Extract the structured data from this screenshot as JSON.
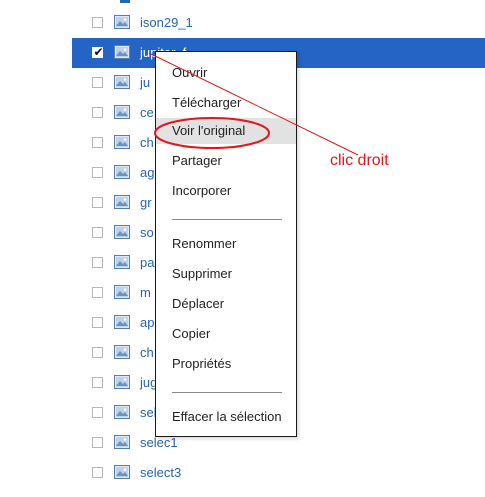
{
  "file_list": {
    "rows": [
      {
        "name": "ison29_1",
        "selected": false
      },
      {
        "name": "jupiter_f",
        "selected": true
      },
      {
        "name": "ju",
        "selected": false
      },
      {
        "name": "ce",
        "selected": false
      },
      {
        "name": "ch",
        "selected": false
      },
      {
        "name": "ag",
        "selected": false
      },
      {
        "name": "gr",
        "selected": false
      },
      {
        "name": "so",
        "selected": false
      },
      {
        "name": "pa",
        "selected": false
      },
      {
        "name": "m",
        "selected": false
      },
      {
        "name": "ap",
        "selected": false
      },
      {
        "name": "ch",
        "selected": false
      },
      {
        "name": "jug",
        "selected": false
      },
      {
        "name": "sel",
        "selected": false
      },
      {
        "name": "selec1",
        "selected": false
      },
      {
        "name": "select3",
        "selected": false
      }
    ]
  },
  "context_menu": {
    "items": [
      {
        "label": "Ouvrir",
        "highlighted": false
      },
      {
        "label": "Télécharger",
        "highlighted": false
      },
      {
        "label": "Voir l'original",
        "highlighted": true
      },
      {
        "label": "Partager",
        "highlighted": false
      },
      {
        "label": "Incorporer",
        "highlighted": false
      },
      {
        "label": "Renommer",
        "highlighted": false
      },
      {
        "label": "Supprimer",
        "highlighted": false
      },
      {
        "label": "Déplacer",
        "highlighted": false
      },
      {
        "label": "Copier",
        "highlighted": false
      },
      {
        "label": "Propriétés",
        "highlighted": false
      },
      {
        "label": "Effacer la sélection",
        "highlighted": false
      }
    ]
  },
  "annotation": {
    "label": "clic droit",
    "color": "#e0171b"
  },
  "colors": {
    "selection": "#2563c4",
    "link": "#2565b3"
  }
}
